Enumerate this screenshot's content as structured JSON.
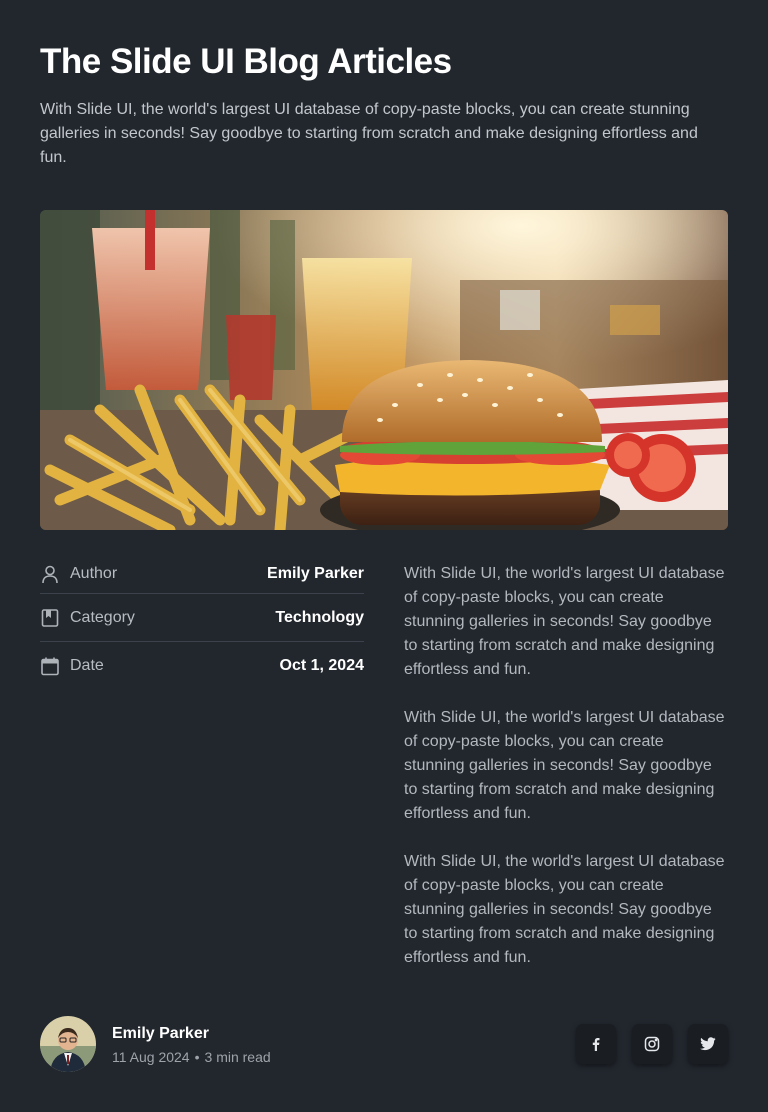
{
  "header": {
    "title": "The Slide UI Blog Articles",
    "intro": "With Slide UI, the world's largest UI database of copy-paste blocks, you can create stunning galleries in seconds! Say goodbye to starting from scratch and make designing effortless and fun."
  },
  "hero_image": {
    "description_icon": "burger-fries-image"
  },
  "meta": {
    "rows": [
      {
        "icon": "user-icon",
        "label": "Author",
        "value": "Emily Parker"
      },
      {
        "icon": "bookmark-icon",
        "label": "Category",
        "value": "Technology"
      },
      {
        "icon": "calendar-icon",
        "label": "Date",
        "value": "Oct 1, 2024"
      }
    ]
  },
  "article": {
    "paragraphs": [
      "With Slide UI, the world's largest UI database of copy-paste blocks, you can create stunning galleries in seconds! Say goodbye to starting from scratch and make designing effortless and fun.",
      "With Slide UI, the world's largest UI database of copy-paste blocks, you can create stunning galleries in seconds! Say goodbye to starting from scratch and make designing effortless and fun.",
      "With Slide UI, the world's largest UI database of copy-paste blocks, you can create stunning galleries in seconds! Say goodbye to starting from scratch and make designing effortless and fun."
    ]
  },
  "footer": {
    "author_name": "Emily Parker",
    "date": "11 Aug 2024",
    "separator": "•",
    "read_time": "3 min read",
    "socials": [
      {
        "icon": "facebook-icon",
        "glyph": "f"
      },
      {
        "icon": "instagram-icon"
      },
      {
        "icon": "twitter-icon"
      }
    ]
  },
  "colors": {
    "background": "#22272e",
    "heading": "#ffffff",
    "body_text": "#b3b8bf",
    "divider": "#3c424b",
    "social_button_bg": "#1a1e23"
  }
}
